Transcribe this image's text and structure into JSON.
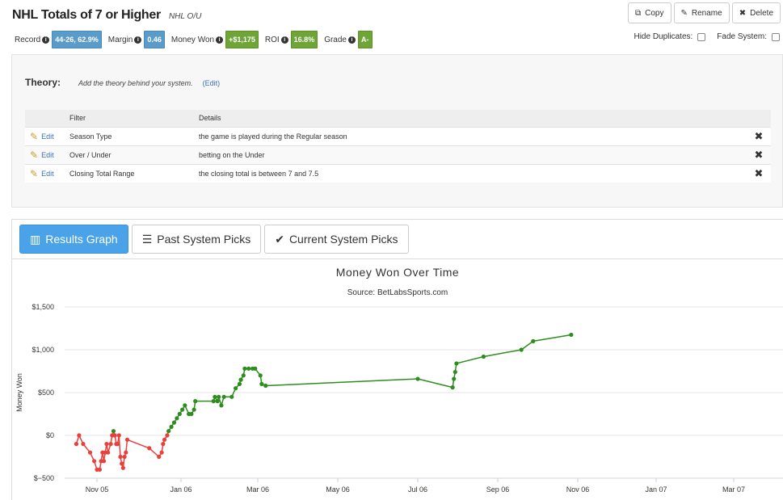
{
  "header": {
    "title": "NHL Totals of 7 or Higher",
    "subtitle": "NHL O/U"
  },
  "toolbar": {
    "copy": "Copy",
    "rename": "Rename",
    "delete": "Delete"
  },
  "stats": [
    {
      "label": "Record",
      "value": "44-26, 62.9%",
      "color": "#5b9bc9"
    },
    {
      "label": "Margin",
      "value": "0.46",
      "color": "#5b9bc9"
    },
    {
      "label": "Money Won",
      "value": "+$1,175",
      "color": "#6fa437"
    },
    {
      "label": "ROI",
      "value": "16.8%",
      "color": "#6fa437"
    },
    {
      "label": "Grade",
      "value": "A-",
      "color": "#6fa437"
    }
  ],
  "toggles": {
    "hide_duplicates": "Hide Duplicates:",
    "fade_system": "Fade System:"
  },
  "theory": {
    "label": "Theory:",
    "text": "Add the theory behind your system.",
    "edit": "(Edit)"
  },
  "filters": {
    "headers": [
      "Filter",
      "Details"
    ],
    "edit_label": "Edit",
    "rows": [
      {
        "filter": "Season Type",
        "details": "the game is played during the Regular season"
      },
      {
        "filter": "Over / Under",
        "details": "betting on the Under"
      },
      {
        "filter": "Closing Total Range",
        "details": "the closing total is between 7 and 7.5"
      }
    ]
  },
  "tabs": {
    "results": "Results Graph",
    "past": "Past System Picks",
    "current": "Current System Picks"
  },
  "chart_data": {
    "type": "line",
    "title": "Money Won Over Time",
    "subtitle": "Source: BetLabsSports.com",
    "ylabel": "Money Won",
    "ylim": [
      -500,
      1500
    ],
    "yticks": [
      "$1,500",
      "$1,000",
      "$500",
      "$0",
      "$−500"
    ],
    "xticks": [
      "Nov 05",
      "Jan 06",
      "Mar 06",
      "May 06",
      "Jul 06",
      "Sep 06",
      "Nov 06",
      "Jan 07",
      "Mar 07"
    ],
    "grid": true,
    "colors": {
      "negative": "#e8403c",
      "positive": "#2f8c1f"
    },
    "series": [
      {
        "values": [
          [
            -15,
            -100
          ],
          [
            -13,
            0
          ],
          [
            -10,
            -100
          ],
          [
            -5,
            -200
          ],
          [
            -2,
            -300
          ],
          [
            0,
            -400
          ],
          [
            2,
            -400
          ],
          [
            3,
            -300
          ],
          [
            4,
            -200
          ],
          [
            5,
            -300
          ],
          [
            6,
            -200
          ],
          [
            7,
            -100
          ],
          [
            8,
            -200
          ],
          [
            10,
            -100
          ],
          [
            11,
            0
          ],
          [
            12,
            50
          ],
          [
            13,
            0
          ],
          [
            14,
            -100
          ],
          [
            15,
            -100
          ],
          [
            16,
            0
          ],
          [
            17,
            -250
          ],
          [
            18,
            -330
          ],
          [
            19,
            -380
          ],
          [
            20,
            -250
          ],
          [
            21,
            -200
          ],
          [
            22,
            -50
          ],
          [
            38,
            -150
          ],
          [
            45,
            -250
          ],
          [
            47,
            -200
          ],
          [
            48,
            -100
          ],
          [
            49,
            -50
          ],
          [
            51,
            0
          ],
          [
            52,
            50
          ],
          [
            54,
            100
          ],
          [
            56,
            150
          ],
          [
            58,
            200
          ],
          [
            60,
            250
          ],
          [
            62,
            300
          ],
          [
            64,
            350
          ],
          [
            67,
            250
          ],
          [
            69,
            250
          ],
          [
            71,
            300
          ],
          [
            72,
            400
          ],
          [
            86,
            400
          ],
          [
            87,
            450
          ],
          [
            89,
            400
          ],
          [
            90,
            450
          ],
          [
            92,
            350
          ],
          [
            94,
            450
          ],
          [
            100,
            450
          ],
          [
            103,
            550
          ],
          [
            106,
            600
          ],
          [
            107,
            650
          ],
          [
            109,
            700
          ],
          [
            110,
            780
          ],
          [
            113,
            780
          ],
          [
            116,
            780
          ],
          [
            118,
            780
          ],
          [
            122,
            700
          ],
          [
            123,
            600
          ],
          [
            126,
            580
          ],
          [
            242,
            660
          ],
          [
            269,
            560
          ],
          [
            270,
            660
          ],
          [
            271,
            740
          ],
          [
            272,
            840
          ],
          [
            293,
            920
          ],
          [
            322,
            1000
          ],
          [
            331,
            1100
          ],
          [
            360,
            1175
          ]
        ]
      }
    ]
  }
}
